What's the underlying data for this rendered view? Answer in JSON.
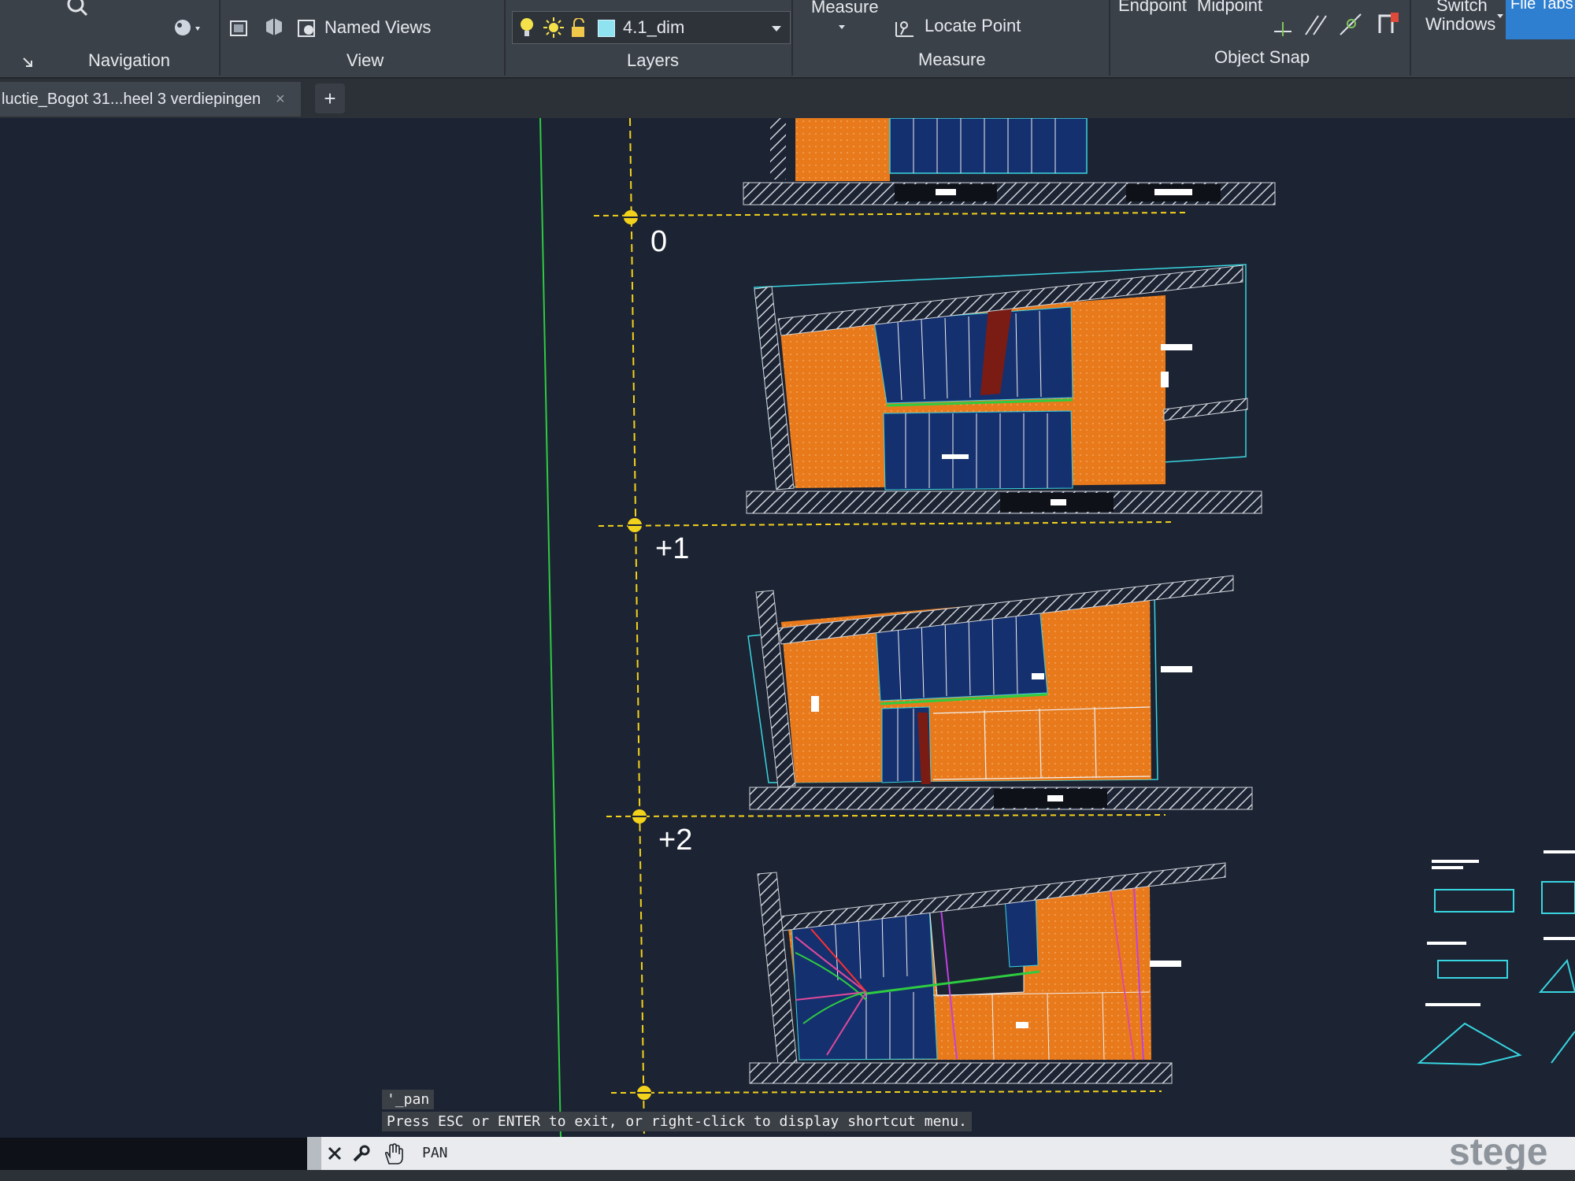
{
  "ribbon": {
    "named_views_label": "Named Views",
    "layer_current": "4.1_dim",
    "measure_label": "Measure",
    "locate_point_label": "Locate Point",
    "endpoint_label": "Endpoint",
    "midpoint_label": "Midpoint",
    "switch_windows_line1": "Switch",
    "switch_windows_line2": "Windows",
    "file_tabs_label": "File Tabs",
    "panels": {
      "navigation": "Navigation",
      "view": "View",
      "layers": "Layers",
      "measure": "Measure",
      "object_snap": "Object Snap"
    }
  },
  "file_tab": {
    "title": "luctie_Bogot 31...heel 3 verdiepingen",
    "close_symbol": "×",
    "new_symbol": "+"
  },
  "drawing": {
    "levels": [
      "0",
      "+1",
      "+2"
    ]
  },
  "command": {
    "history_1": "'_pan",
    "history_2": "Press ESC or ENTER to exit, or right-click to display shortcut menu.",
    "input": "PAN"
  },
  "brand_text": "stege",
  "colors": {
    "orange_fill": "#e87a1c",
    "panel_blue": "#1a3a8c",
    "level_line": "#f2d21b",
    "cyan_outline": "#38d6e0",
    "green_axis": "#2ecc40"
  }
}
